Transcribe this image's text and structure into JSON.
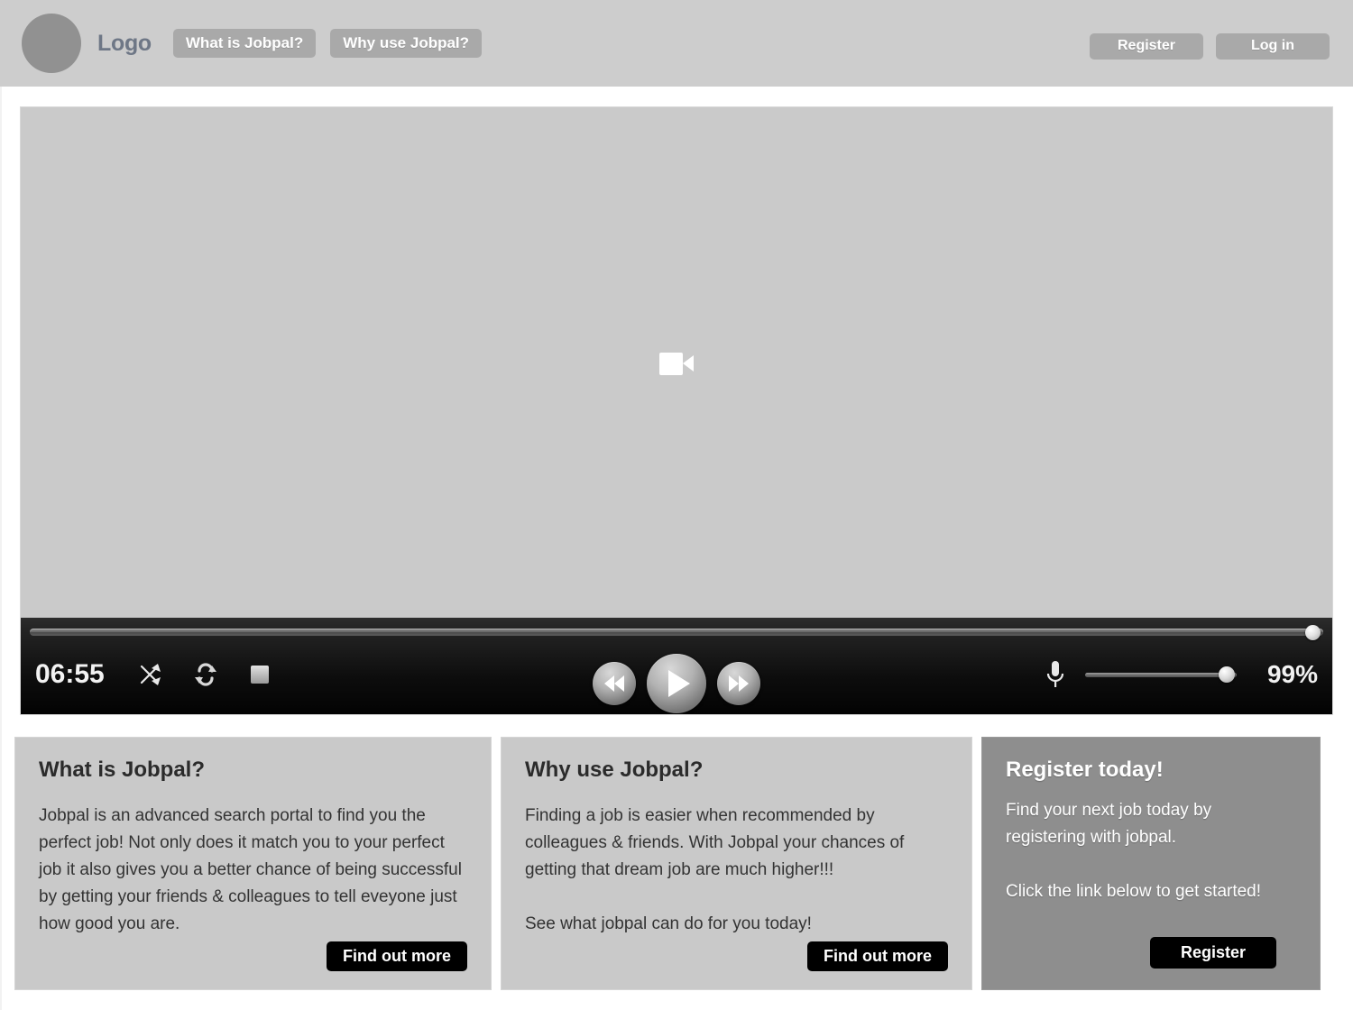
{
  "header": {
    "logo_label": "Logo",
    "avatar_icon": "avatar-circle-icon",
    "nav_items": [
      {
        "label": "What is Jobpal?"
      },
      {
        "label": "Why use Jobpal?"
      }
    ],
    "auth_items": [
      {
        "label": "Register"
      },
      {
        "label": "Log in"
      }
    ]
  },
  "video": {
    "placeholder_icon": "video-camera-icon",
    "controls": {
      "time": "06:55",
      "shuffle_icon": "shuffle-icon",
      "repeat_icon": "repeat-icon",
      "stop_icon": "stop-icon",
      "rewind_icon": "rewind-icon",
      "play_icon": "play-icon",
      "forward_icon": "fast-forward-icon",
      "microphone_icon": "microphone-icon",
      "volume_percent": "99%",
      "progress_position": "98.6",
      "volume_position": "88"
    }
  },
  "cards": [
    {
      "title": "What is Jobpal?",
      "paragraphs": [
        "Jobpal is an advanced search portal to find you the perfect job! Not only does it match you to your perfect job it also gives you a better chance of being successful by getting your friends & colleagues to tell eveyone just how good you are."
      ],
      "cta_label": "Find out more"
    },
    {
      "title": "Why use Jobpal?",
      "paragraphs": [
        "Finding a job is easier when recommended by colleagues & friends. With Jobpal your chances of getting that dream job are much higher!!!",
        "See what jobpal can do for you today!"
      ],
      "cta_label": "Find out more"
    },
    {
      "title": "Register today!",
      "paragraphs": [
        "Find your next job today by registering with jobpal.",
        "Click the link below to get started!"
      ],
      "cta_label": "Register"
    }
  ],
  "colors": {
    "header_bg": "#cdcdcd",
    "nav_pill_bg": "#a9a9a9",
    "card_light_bg": "#c9c9c9",
    "card_dark_bg": "#8e8e8e",
    "cta_bg": "#000000",
    "video_stage_bg": "#cacaca",
    "logo_text": "#6e7786"
  }
}
